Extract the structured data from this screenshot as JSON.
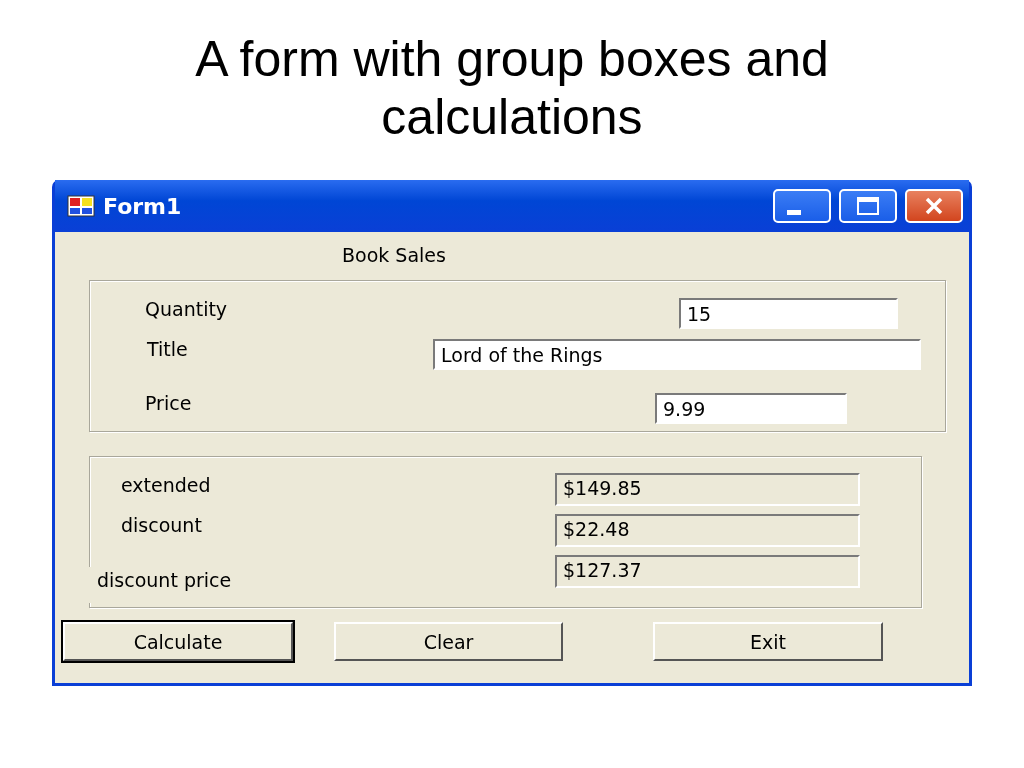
{
  "slide_title": "A form with group boxes and calculations",
  "window": {
    "title": "Form1"
  },
  "heading": "Book Sales",
  "inputs": [
    {
      "label": "Quantity",
      "value": "15"
    },
    {
      "label": "Title",
      "value": "Lord of the Rings"
    },
    {
      "label": "Price",
      "value": "9.99"
    }
  ],
  "results": [
    {
      "label": "extended",
      "value": "$149.85"
    },
    {
      "label": "discount",
      "value": "$22.48"
    },
    {
      "label": "discount price",
      "value": "$127.37"
    }
  ],
  "buttons": [
    {
      "label": "Calculate",
      "default": true
    },
    {
      "label": "Clear",
      "default": false
    },
    {
      "label": "Exit",
      "default": false
    }
  ]
}
